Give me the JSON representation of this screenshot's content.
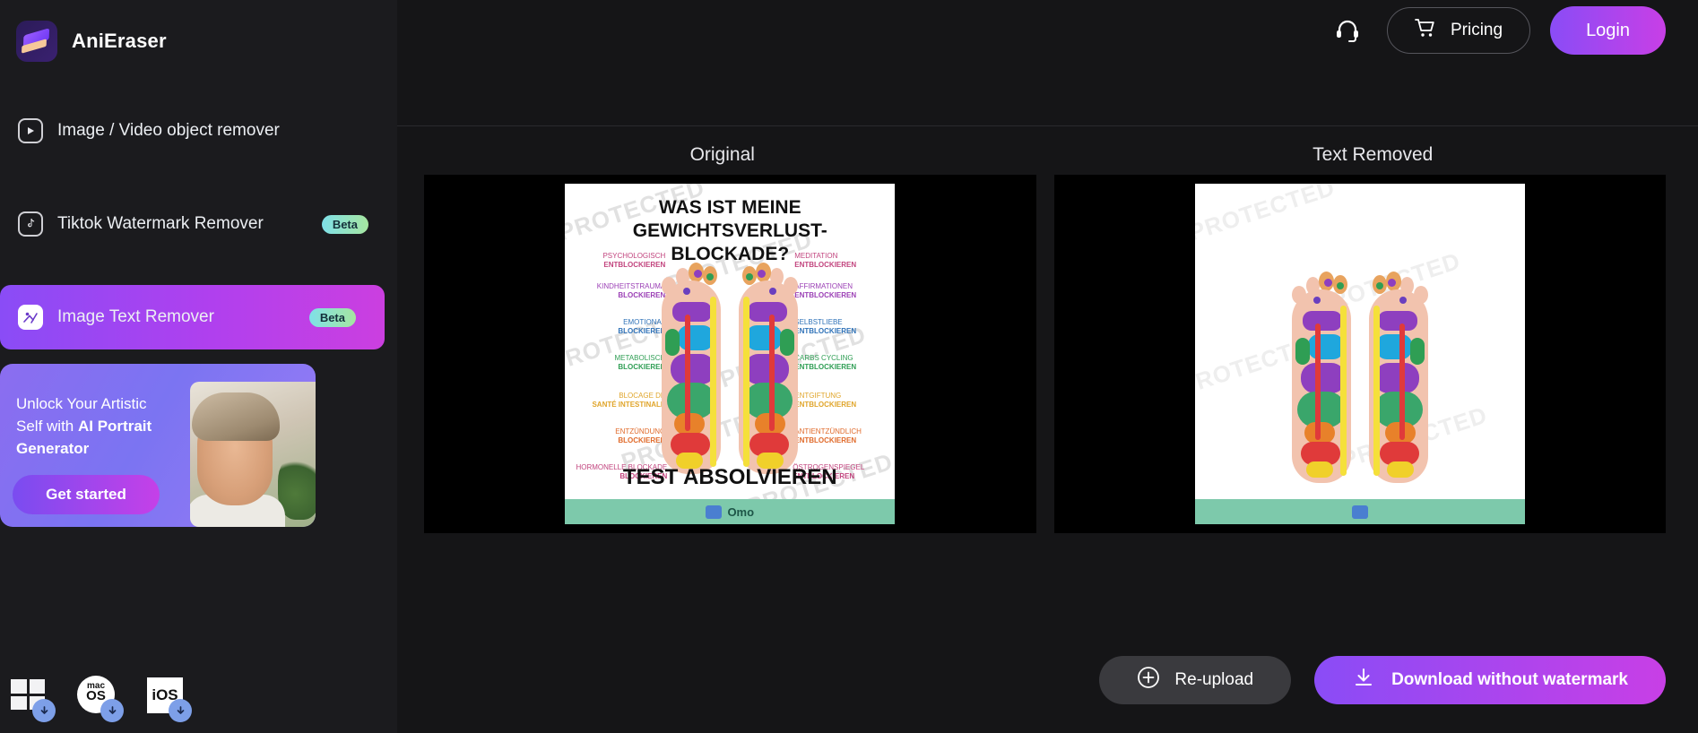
{
  "brand": {
    "name": "AniEraser",
    "logo_icon": "eraser-icon"
  },
  "sidebar": {
    "items": [
      {
        "label": "Image / Video object remover",
        "icon": "play-square-icon",
        "badge": null,
        "active": false
      },
      {
        "label": "Tiktok Watermark Remover",
        "icon": "tiktok-note-icon",
        "badge": "Beta",
        "active": false
      },
      {
        "label": "Image Text Remover",
        "icon": "image-text-icon",
        "badge": "Beta",
        "active": true
      }
    ],
    "promo": {
      "line1": "Unlock Your Artistic",
      "line2_plain": "Self with ",
      "line2_bold": "AI Portrait",
      "line3_bold": "Generator",
      "button": "Get started"
    },
    "downloads": [
      {
        "name": "Windows",
        "icon": "windows-icon"
      },
      {
        "name": "macOS",
        "icon": "macos-icon",
        "label_top": "mac",
        "label_bottom": "OS"
      },
      {
        "name": "iOS",
        "icon": "ios-icon",
        "label": "iOS"
      }
    ]
  },
  "header": {
    "support_icon": "headset-icon",
    "pricing_label": "Pricing",
    "pricing_icon": "cart-icon",
    "login_label": "Login"
  },
  "panels": {
    "original_title": "Original",
    "result_title": "Text Removed"
  },
  "image_content": {
    "title_line1": "WAS IST MEINE GEWICHTSVERLUST-",
    "title_line2": "BLOCKADE?",
    "cta": "TEST ABSOLVIEREN",
    "footer_text": "Omo",
    "watermark": "PROTECTED",
    "labels_left": [
      {
        "top": "PSYCHOLOGISCH",
        "bottom": "ENTBLOCKIEREN",
        "color": "#c2447e"
      },
      {
        "top": "KINDHEITSTRAUMA",
        "bottom": "BLOCKIEREN",
        "color": "#9b3fb5"
      },
      {
        "top": "EMOTIONAL",
        "bottom": "BLOCKIEREN",
        "color": "#2f72b8"
      },
      {
        "top": "METABOLISCH",
        "bottom": "BLOCKIEREN",
        "color": "#2f9e54"
      },
      {
        "top": "BLOCAGE DE",
        "bottom": "SANTÉ INTESTINALE",
        "color": "#e0a52a"
      },
      {
        "top": "ENTZÜNDUNG",
        "bottom": "BLOCKIEREN",
        "color": "#e06a2a"
      },
      {
        "top": "HORMONELLE BLOCKADE",
        "bottom": "BLOCKIEREN",
        "color": "#c2447e"
      }
    ],
    "labels_right": [
      {
        "top": "MEDITATION",
        "bottom": "ENTBLOCKIEREN",
        "color": "#c2447e"
      },
      {
        "top": "AFFIRMATIONEN",
        "bottom": "ENTBLOCKIEREN",
        "color": "#9b3fb5"
      },
      {
        "top": "SELBSTLIEBE",
        "bottom": "ENTBLOCKIEREN",
        "color": "#2f72b8"
      },
      {
        "top": "CARBS CYCLING",
        "bottom": "ENTBLOCKIEREN",
        "color": "#2f9e54"
      },
      {
        "top": "ENTGIFTUNG",
        "bottom": "ENTBLOCKIEREN",
        "color": "#e0a52a"
      },
      {
        "top": "ANTIENTZÜNDLICH",
        "bottom": "ENTBLOCKIEREN",
        "color": "#e06a2a"
      },
      {
        "top": "ÖSTROGENSPIEGEL",
        "bottom": "ENTBLOCKIEREN",
        "color": "#c2447e"
      }
    ]
  },
  "actions": {
    "reupload_label": "Re-upload",
    "reupload_icon": "plus-circle-icon",
    "download_label": "Download without watermark",
    "download_icon": "download-icon"
  },
  "colors": {
    "accent_start": "#8a4cf6",
    "accent_end": "#c83fe6",
    "sidebar_bg": "#1b1b1e",
    "main_bg": "#151517",
    "badge_bg": "#7fe0e8"
  }
}
